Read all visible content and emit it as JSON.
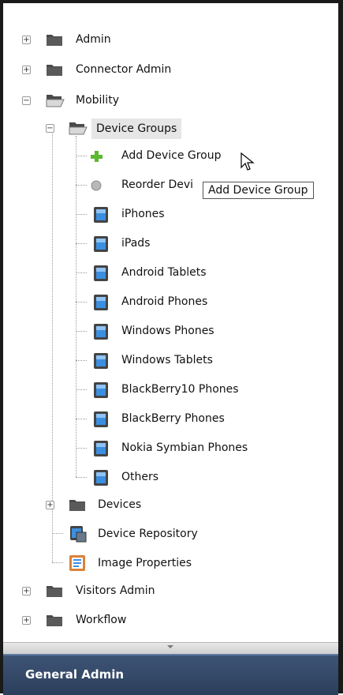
{
  "tree": {
    "admin": "Admin",
    "connector_admin": "Connector Admin",
    "mobility": "Mobility",
    "device_groups": "Device Groups",
    "add_device_group": "Add Device Group",
    "reorder": "Reorder Devi",
    "iphones": "iPhones",
    "ipads": "iPads",
    "android_tablets": "Android Tablets",
    "android_phones": "Android Phones",
    "windows_phones": "Windows Phones",
    "windows_tablets": "Windows Tablets",
    "blackberry10": "BlackBerry10 Phones",
    "blackberry": "BlackBerry Phones",
    "nokia": "Nokia Symbian Phones",
    "others": "Others",
    "devices": "Devices",
    "device_repository": "Device Repository",
    "image_properties": "Image Properties",
    "visitors_admin": "Visitors Admin",
    "workflow": "Workflow"
  },
  "tooltip": "Add Device Group",
  "footer": {
    "title": "General Admin"
  },
  "colors": {
    "footer_bg": "#34496b",
    "selected_bg": "#e6e6e6",
    "folder": "#4a4a4a"
  }
}
